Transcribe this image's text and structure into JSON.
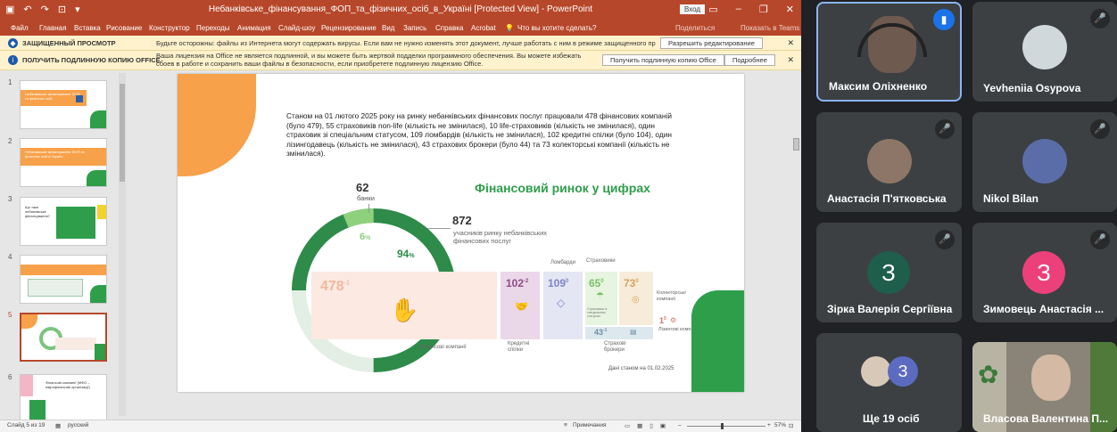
{
  "window": {
    "title": "Небанківське_фінансування_ФОП_та_фізичних_осіб_в_Україні [Protected View] - PowerPoint",
    "login": "Вход"
  },
  "ribbon": {
    "tabs": [
      "Файл",
      "Главная",
      "Вставка",
      "Рисование",
      "Конструктор",
      "Переходы",
      "Анимация",
      "Слайд-шоу",
      "Рецензирование",
      "Вид",
      "Запись",
      "Справка",
      "Acrobat"
    ],
    "tell_me": "Что вы хотите сделать?",
    "share": "Поделиться",
    "pokaz": "Показать в Teams"
  },
  "protected_bar": {
    "title": "ЗАЩИЩЕННЫЙ ПРОСМОТР",
    "message": "Будьте осторожны: файлы из Интернета могут содержать вирусы. Если вам не нужно изменять этот документ, лучше работать с ним в режиме защищенного просмотра.",
    "button": "Разрешить редактирование"
  },
  "license_bar": {
    "title": "ПОЛУЧИТЬ ПОДЛИННУЮ КОПИЮ OFFICE",
    "message": "Ваша лицензия на Office не является подлинной, и вы можете быть жертвой подделки программного обеспечения. Вы можете избежать сбоев в работе и сохранить ваши файлы в безопасности, если приобретете подлинную лицензию Office.",
    "button": "Получить подлинную копию Office",
    "button2": "Подробнее"
  },
  "thumbnails": [
    {
      "num": "1",
      "text": "Небанківське фінансування ФОП та фізичних осіб"
    },
    {
      "num": "2",
      "text": "Небанківське фінансування ФОП та фізичних осіб в Україні"
    },
    {
      "num": "3",
      "text": "Що таке небанківське фінансування?"
    },
    {
      "num": "4",
      "text": ""
    },
    {
      "num": "5",
      "text": ""
    },
    {
      "num": "6",
      "text": "Фінансові компанії (МФО – мікрофінансові організації)"
    }
  ],
  "slide": {
    "intro": "Станом на 01 лютого 2025 року на ринку небанківських фінансових послуг працювали 478 фінансових компаній (було 479), 55 страховиків non-life (кількість не змінилася), 10 life-страховиків (кількість не змінилася), один страховик зі спеціальним статусом, 109 ломбардів (кількість не змінилася), 102 кредитні спілки (було 104), один лізингодавець (кількість не змінилася), 43 страхових брокери (було 44) та 73 колекторські компанії (кількість не змінилася).",
    "heading": "Фінансовий ринок у цифрах",
    "banks_num": "62",
    "banks_label": "банки",
    "total_num": "872",
    "total_label": "учасників ринку небанківських фінансових послуг",
    "pct_small": "6",
    "pct_big": "94",
    "pct_sign": "%",
    "fin": {
      "num": "478",
      "sup": "-1",
      "label": "Фінансові компанії"
    },
    "cu": {
      "num": "102",
      "sup": "-2",
      "label": "Кредитні спілки"
    },
    "lomb": {
      "num": "109",
      "sup": "0",
      "label": "Ломбарди"
    },
    "ins": {
      "num": "65",
      "sup": "0",
      "label": "Страховики",
      "sub": "Страховики зі спеціальним статусом"
    },
    "coll": {
      "num": "73",
      "sup": "0",
      "label": "Колекторські компанії"
    },
    "leas": {
      "num": "1",
      "sup": "0",
      "label": "Лізингові компанії"
    },
    "brok": {
      "num": "43",
      "sup": "-1",
      "label": "Страхові брокери"
    },
    "footnote": "Дані станом на 01.02.2025"
  },
  "status": {
    "slide": "Слайд 5 из 19",
    "lang": "русский",
    "notes": "Примечания",
    "zoom": "57%"
  },
  "participants": [
    {
      "name": "Максим Оліхненко",
      "initial": "",
      "color": "#5f6368"
    },
    {
      "name": "Yevheniia Osypova",
      "initial": "",
      "color": "#b9c4c8"
    },
    {
      "name": "Анастасія П'ятковська",
      "initial": "",
      "color": "#8d7668"
    },
    {
      "name": "Nikol Bilan",
      "initial": "",
      "color": "#5a6da8"
    },
    {
      "name": "Зірка Валерія Сергіївна",
      "initial": "З",
      "color": "#1e5e4a"
    },
    {
      "name": "Зимовець Анастасія ...",
      "initial": "З",
      "color": "#ec407a"
    },
    {
      "name": "Ще 19 осіб",
      "initial": "З",
      "color": "#5c6bc0"
    },
    {
      "name": "Власова Валентина П...",
      "initial": "",
      "color": "#a6a29a"
    }
  ]
}
